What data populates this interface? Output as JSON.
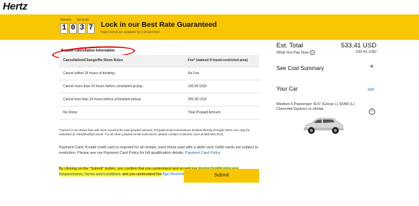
{
  "brand": {
    "logo_text": "Hertz"
  },
  "banner": {
    "timer_label_minutes": "Minutes",
    "timer_label_seconds": "Seconds",
    "digits": [
      "1",
      "0",
      "3",
      "7"
    ],
    "title": "Lock in our Best Rate Guaranteed",
    "subtitle": "Rates below are available for a limited time."
  },
  "policy": {
    "title": "Prepaid Cancellation Information",
    "headers": [
      "Cancellation/Change/No Show Rules",
      "Fee* (waived if travel-restricted area)"
    ],
    "rows": [
      [
        "Cancel within 24 hours of booking",
        "No Fee"
      ],
      [
        "Cancel more than 24 hours before scheduled pickup",
        "100.00 USD"
      ],
      [
        "Cancel less than 24 hours before scheduled pickup",
        "200.00 USD"
      ],
      [
        "No-Show",
        "Total Prepaid Amount"
      ]
    ],
    "fee_note": "*Cancel or No-Show fees will never exceed the total prepaid amount. Prepaid rental reservations booked directly through Hertz.com may be extended at View/Modify/Cancel. For all other prepaid rental extensions, please contact Customer Care at 800-654-3131."
  },
  "payment": {
    "text": "Payment Card: A valid credit card is required for all rentals, even those paid with a debit card. Debit cards are subject to restriction. Please see our Payment Card Policy for full qualification details.",
    "link": "Payment Card Policy"
  },
  "terms": {
    "prefix": "By clicking on the \"Submit\" button, you confirm that you understand and accept our",
    "link1": "Rental Qualification and Requirements, Terms and Conditions",
    "middle": "and you understand the",
    "link2": "Age Restrictions"
  },
  "submit_label": "Submit",
  "summary": {
    "est_total_label": "Est. Total",
    "est_total_amount": "533.41 USD",
    "pay_now_label": "What You Pay Now",
    "pay_now_amount": "533.41 USD",
    "see_cost_label": "See Cost Summary",
    "plus_symbol": "+",
    "your_car_label": "Your Car",
    "edit_label": "Edit",
    "car_description": "Medium 5 Passenger SUV (Group L) SFAR (L) Chevrolet Equinox or similar",
    "info_symbol": "i"
  },
  "colors": {
    "banner": "#f7c600",
    "link": "#1a5fb4",
    "highlight": "#fff200",
    "annotation": "#e00000"
  },
  "icons": {
    "info": "info-icon",
    "car": "car-image"
  }
}
